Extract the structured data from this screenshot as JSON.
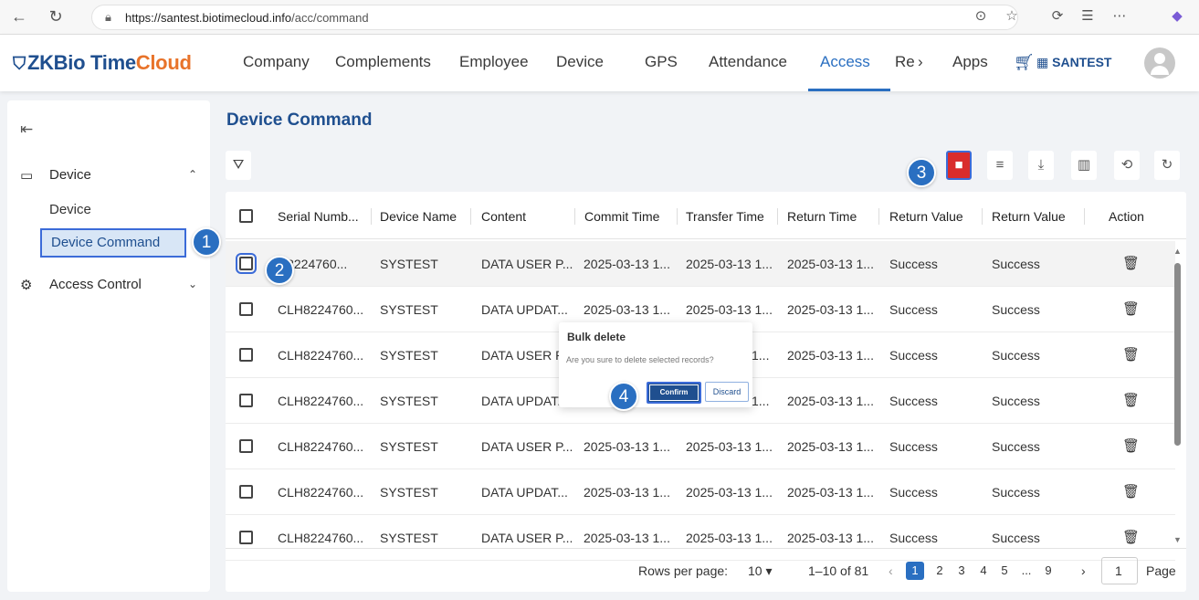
{
  "browser": {
    "url_host": "https://santest.biotimecloud.info",
    "url_path": "/acc/command"
  },
  "header": {
    "logo_zk": "ZKBio Time",
    "logo_cloud": "Cloud",
    "nav": [
      "Company",
      "Complements",
      "Employee",
      "Device",
      "GPS",
      "Attendance",
      "Access",
      "Re",
      "Apps"
    ],
    "nav_more": "›",
    "company_name": "SANTEST"
  },
  "sidebar": {
    "groups": [
      {
        "label": "Device",
        "chevron": "⌃"
      },
      {
        "label": "Access Control",
        "chevron": "⌄"
      }
    ],
    "items": [
      "Device",
      "Device Command"
    ]
  },
  "main": {
    "title": "Device Command",
    "columns": [
      "Serial Numb...",
      "Device Name",
      "Content",
      "Commit Time",
      "Transfer Time",
      "Return Time",
      "Return Value",
      "Return Value",
      "Action"
    ],
    "rows": [
      {
        "serial": "H8224760...",
        "name": "SYSTEST",
        "content": "DATA USER P...",
        "commit": "2025-03-13 1...",
        "transfer": "2025-03-13 1...",
        "ret_time": "2025-03-13 1...",
        "ret_val": "Success",
        "ret_val2": "Success"
      },
      {
        "serial": "CLH8224760...",
        "name": "SYSTEST",
        "content": "DATA UPDAT...",
        "commit": "2025-03-13 1...",
        "transfer": "2025-03-13 1...",
        "ret_time": "2025-03-13 1...",
        "ret_val": "Success",
        "ret_val2": "Success"
      },
      {
        "serial": "CLH8224760...",
        "name": "SYSTEST",
        "content": "DATA USER P.",
        "commit": "",
        "transfer": "1...",
        "ret_time": "2025-03-13 1...",
        "ret_val": "Success",
        "ret_val2": "Success"
      },
      {
        "serial": "CLH8224760...",
        "name": "SYSTEST",
        "content": "DATA UPDAT.",
        "commit": "",
        "transfer": "1...",
        "ret_time": "2025-03-13 1...",
        "ret_val": "Success",
        "ret_val2": "Success"
      },
      {
        "serial": "CLH8224760...",
        "name": "SYSTEST",
        "content": "DATA USER P...",
        "commit": "2025-03-13 1...",
        "transfer": "2025-03-13 1...",
        "ret_time": "2025-03-13 1...",
        "ret_val": "Success",
        "ret_val2": "Success"
      },
      {
        "serial": "CLH8224760...",
        "name": "SYSTEST",
        "content": "DATA UPDAT...",
        "commit": "2025-03-13 1...",
        "transfer": "2025-03-13 1...",
        "ret_time": "2025-03-13 1...",
        "ret_val": "Success",
        "ret_val2": "Success"
      },
      {
        "serial": "CLH8224760...",
        "name": "SYSTEST",
        "content": "DATA USER P...",
        "commit": "2025-03-13 1...",
        "transfer": "2025-03-13 1...",
        "ret_time": "2025-03-13 1...",
        "ret_val": "Success",
        "ret_val2": "Success"
      }
    ],
    "pager": {
      "rows_label": "Rows per page:",
      "rows_value": "10 ▾",
      "range": "1–10 of 81",
      "pages": [
        "1",
        "2",
        "3",
        "4",
        "5",
        "...",
        "9"
      ],
      "current": "1",
      "page_label": "Page"
    }
  },
  "popover": {
    "title": "Bulk delete",
    "message": "Are you sure to delete selected records?",
    "confirm": "Confirm",
    "discard": "Discard"
  },
  "steps": [
    "1",
    "2",
    "3",
    "4"
  ],
  "colors": {
    "accent": "#2a6fc1",
    "brand": "#1f4f8f",
    "danger": "#d92c2c",
    "logo_orange": "#e8732a"
  }
}
